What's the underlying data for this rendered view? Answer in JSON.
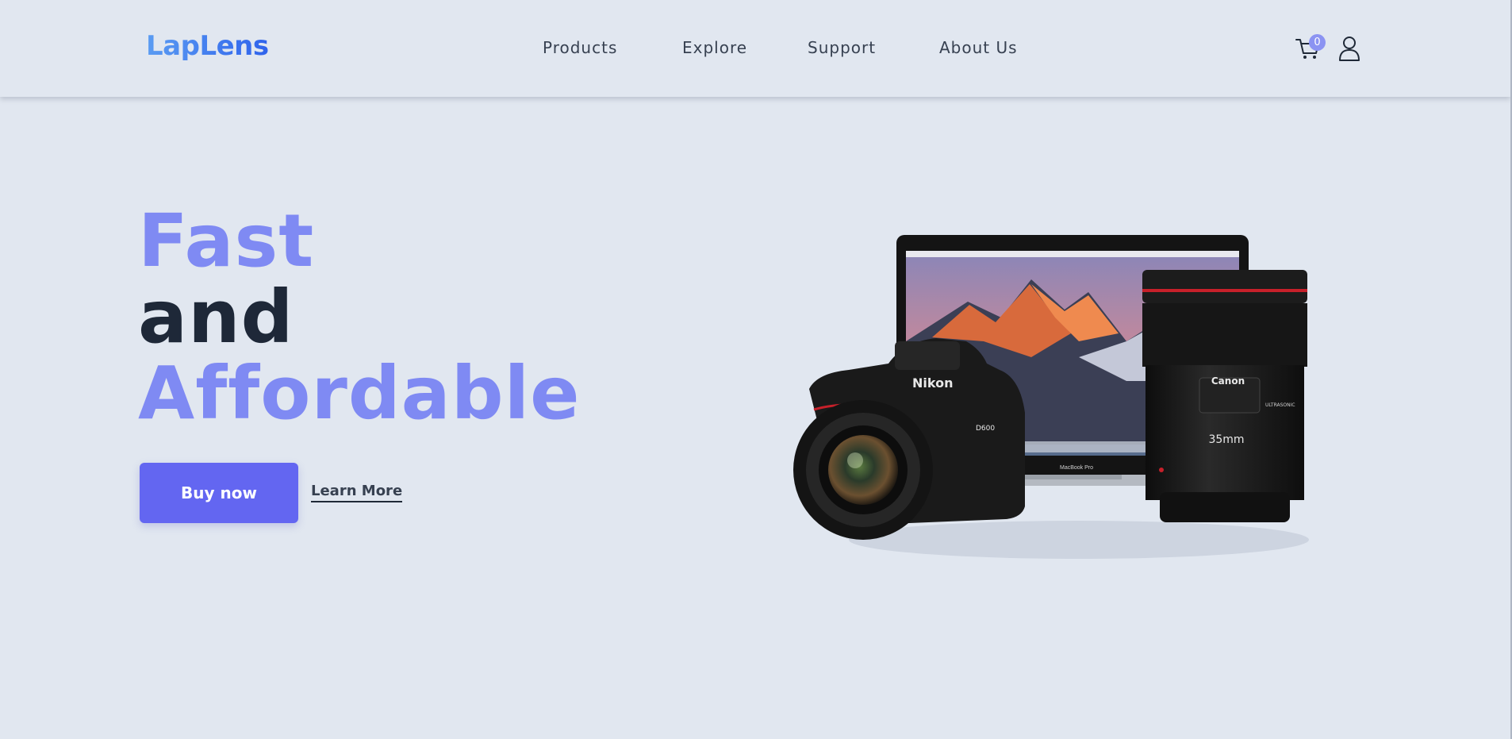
{
  "header": {
    "logo": "LapLens",
    "nav": [
      "Products",
      "Explore",
      "Support",
      "About Us"
    ],
    "cart_count": "0",
    "icons": {
      "cart": "cart-icon",
      "user": "user-icon"
    }
  },
  "hero": {
    "line1": "Fast",
    "line2": "and",
    "line3": "Affordable",
    "buy_label": "Buy now",
    "learn_label": "Learn More"
  },
  "product_image": {
    "laptop_label": "MacBook Pro",
    "camera_brand": "Nikon",
    "camera_model": "D600",
    "lens_brand": "Canon",
    "lens_focal": "35mm",
    "lens_tag": "ULTRASONIC"
  },
  "colors": {
    "background": "#e1e7f0",
    "accent": "#6366f1",
    "hero_accent": "#7f8af3",
    "logo_blue": "#2f63ec",
    "dark_text": "#1e2838"
  }
}
